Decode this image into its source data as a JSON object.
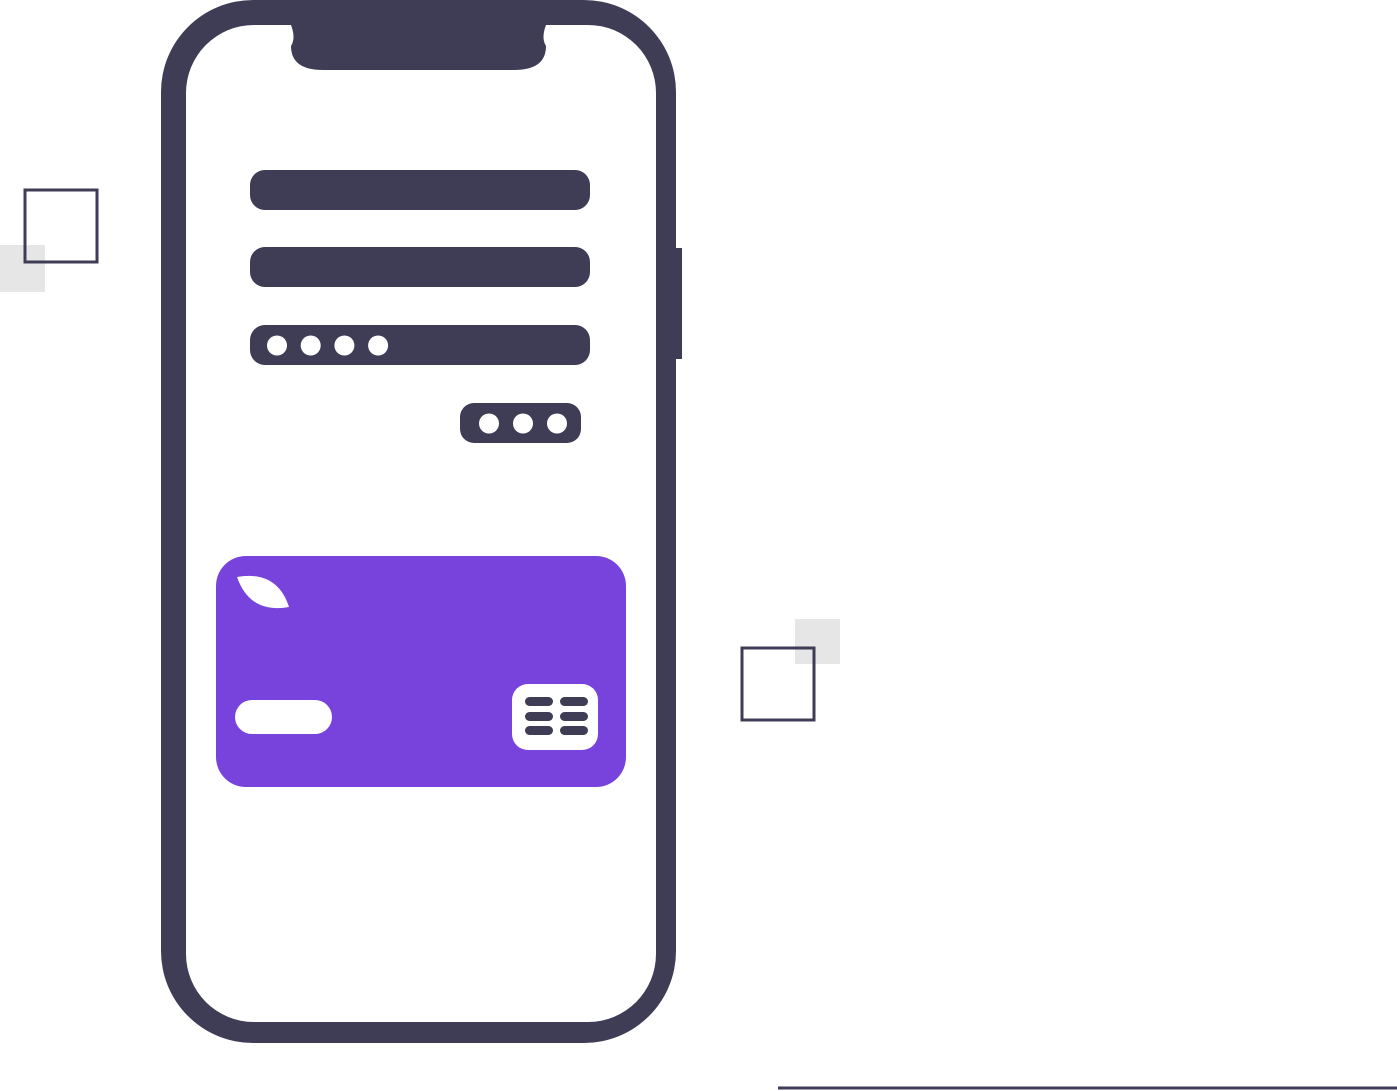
{
  "colors": {
    "phone_frame": "#3f3d56",
    "card": "#7843dd",
    "background": "#ffffff",
    "accent_square": "#e6e6e6",
    "dots": "#ffffff"
  },
  "phone": {
    "icon": "smartphone-icon",
    "fields": [
      {
        "name": "text-field-1",
        "content": "empty"
      },
      {
        "name": "text-field-2",
        "content": "empty"
      },
      {
        "name": "password-field",
        "content": "masked",
        "masked_dots": 4
      }
    ],
    "submit_button": {
      "masked_dots": 3
    }
  },
  "credit_card": {
    "icon": "credit-card-icon",
    "chip_icon": "card-chip-icon",
    "logo_icon": "leaf-icon"
  },
  "decorations": {
    "icons": [
      "outline-square-icon",
      "filled-square-icon",
      "outline-square-icon",
      "filled-square-icon",
      "ground-line"
    ]
  }
}
